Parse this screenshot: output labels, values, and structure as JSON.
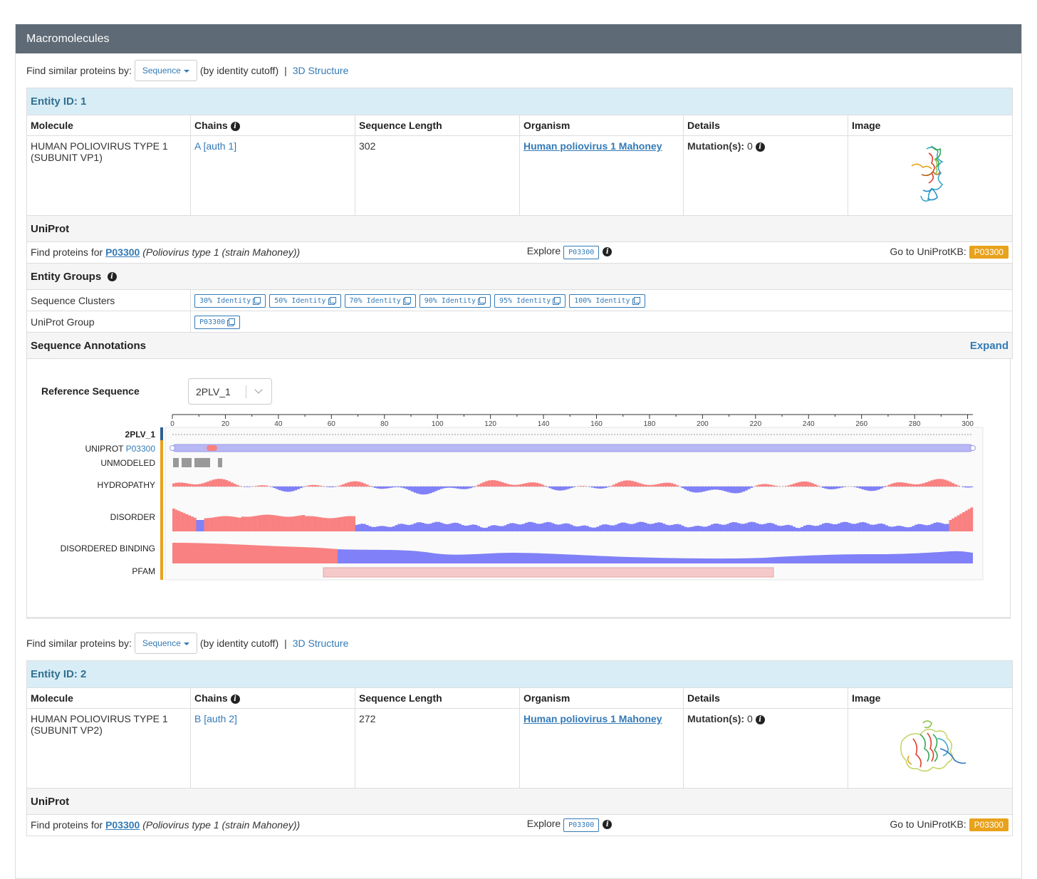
{
  "panel_title": "Macromolecules",
  "find": {
    "label": "Find similar proteins by:",
    "select": "Sequence",
    "cutoff": "(by identity cutoff)",
    "sep": "|",
    "structure": "3D Structure"
  },
  "columns": [
    "Molecule",
    "Chains",
    "Sequence Length",
    "Organism",
    "Details",
    "Image"
  ],
  "entities": [
    {
      "title": "Entity ID: 1",
      "molecule": "HUMAN POLIOVIRUS TYPE 1 (SUBUNIT VP1)",
      "chains": "A [auth 1]",
      "length": "302",
      "organism": "Human poliovirus 1 Mahoney",
      "mutation_label": "Mutation(s):",
      "mutation_value": "0"
    },
    {
      "title": "Entity ID: 2",
      "molecule": "HUMAN POLIOVIRUS TYPE 1 (SUBUNIT VP2)",
      "chains": "B [auth 2]",
      "length": "272",
      "organism": "Human poliovirus 1 Mahoney",
      "mutation_label": "Mutation(s):",
      "mutation_value": "0"
    }
  ],
  "uniprot": {
    "section": "UniProt",
    "find_prefix": "Find proteins for",
    "accession": "P03300",
    "organism_note": "(Poliovirus type 1 (strain Mahoney))",
    "explore": "Explore",
    "goto": "Go to UniProtKB:"
  },
  "groups": {
    "section": "Entity Groups",
    "clusters_label": "Sequence Clusters",
    "clusters": [
      "30% Identity",
      "50% Identity",
      "70% Identity",
      "90% Identity",
      "95% Identity",
      "100% Identity"
    ],
    "uniprot_group_label": "UniProt Group",
    "uniprot_group": "P03300"
  },
  "annotations": {
    "section": "Sequence Annotations",
    "expand": "Expand",
    "ref_label": "Reference Sequence",
    "ref_value": "2PLV_1",
    "ruler_ticks": [
      "0",
      "20",
      "40",
      "60",
      "80",
      "100",
      "120",
      "140",
      "160",
      "180",
      "200",
      "220",
      "240",
      "260",
      "280",
      "300"
    ],
    "tracks": {
      "seq": "2PLV_1",
      "uniprot": "UNIPROT",
      "uniprot_acc": "P03300",
      "unmodeled": "UNMODELED",
      "hydropathy": "HYDROPATHY",
      "disorder": "DISORDER",
      "binding": "DISORDERED BINDING",
      "pfam": "PFAM"
    }
  },
  "colors": {
    "heading": "#5e6a75",
    "entity_bg": "#d9edf7",
    "link": "#337ab7",
    "uniprot_btn": "#e8a21c",
    "positive": "#f98181",
    "negative": "#8080f8"
  }
}
